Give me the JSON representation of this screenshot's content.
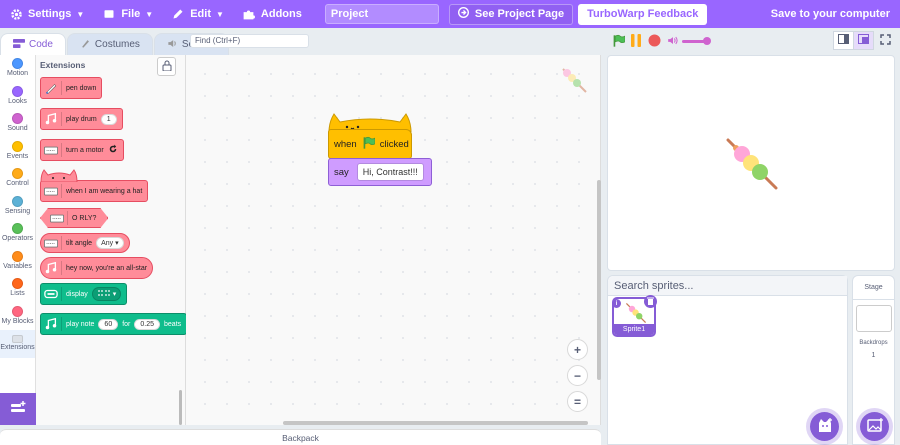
{
  "menu": {
    "settings": "Settings",
    "file": "File",
    "edit": "Edit",
    "addons": "Addons",
    "project_title": "Project",
    "see_project_page": "See Project Page",
    "feedback": "TurboWarp Feedback",
    "save": "Save to your computer"
  },
  "tabs": {
    "code": "Code",
    "costumes": "Costumes",
    "sounds": "Sounds"
  },
  "find_placeholder": "Find (Ctrl+F)",
  "categories": [
    {
      "label": "Motion",
      "color": "#4c97ff"
    },
    {
      "label": "Looks",
      "color": "#9966ff"
    },
    {
      "label": "Sound",
      "color": "#cf63cf"
    },
    {
      "label": "Events",
      "color": "#ffbf00"
    },
    {
      "label": "Control",
      "color": "#ffab19"
    },
    {
      "label": "Sensing",
      "color": "#5cb1d6"
    },
    {
      "label": "Operators",
      "color": "#59c059"
    },
    {
      "label": "Variables",
      "color": "#ff8c1a"
    },
    {
      "label": "Lists",
      "color": "#ff661a"
    },
    {
      "label": "My Blocks",
      "color": "#ff6680"
    },
    {
      "label": "Extensions",
      "color": "#dde1e7"
    }
  ],
  "flyout": {
    "title": "Extensions",
    "blocks": {
      "pen_down": "pen down",
      "play_drum": "play drum",
      "play_drum_val": "1",
      "turn_motor": "turn a motor",
      "wearing_hat": "when I am wearing a hat",
      "orly": "O RLY?",
      "tilt_angle": "tilt angle",
      "tilt_angle_val": "Any",
      "allstar": "hey now, you're an all-star",
      "display": "display",
      "play_note": "play note",
      "play_note_val": "60",
      "for_label": "for",
      "beats_val": "0.25",
      "beats_label": "beats"
    }
  },
  "script": {
    "when_label": "when",
    "clicked_label": "clicked",
    "say_label": "say",
    "say_value": "Hi, Contrast!!!"
  },
  "zoom": {
    "in": "+",
    "out": "−",
    "reset": "="
  },
  "backpack": "Backpack",
  "sprites": {
    "search_placeholder": "Search sprites...",
    "sprite_name": "Sprite1",
    "info": "i"
  },
  "stage_pane": {
    "title": "Stage",
    "backdrops_label": "Backdrops",
    "backdrops_count": "1"
  },
  "colors": {
    "accent": "#9966ff",
    "pen_block": "#ff8c99",
    "green_block": "#0fbd8c",
    "event_block": "#ffbf00",
    "looks_block": "#cf9cff"
  },
  "volume": 0.8
}
